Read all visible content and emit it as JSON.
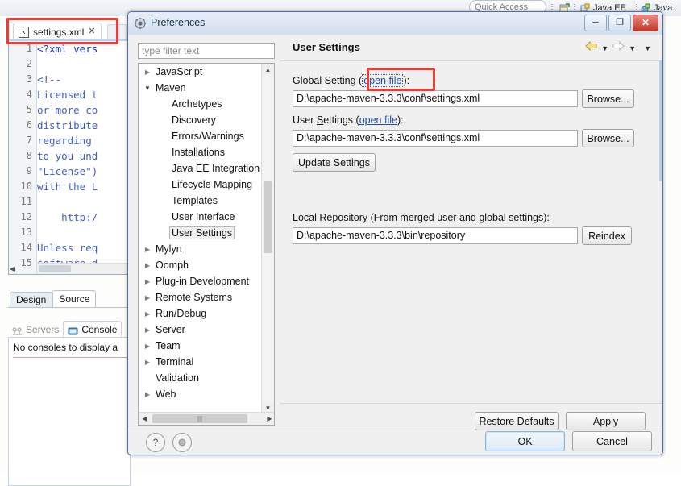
{
  "eclipse": {
    "quick_access": "Quick Access",
    "perspectives": [
      {
        "name": "Java EE",
        "icon": "java-ee-perspective-icon"
      },
      {
        "name": "Java",
        "icon": "java-perspective-icon"
      }
    ],
    "editor_tab": {
      "label": "settings.xml",
      "file_icon": "xml-file-icon",
      "close_icon": "✕"
    },
    "code_lines": [
      {
        "num": "1",
        "text": "<?xml vers"
      },
      {
        "num": "2",
        "text": ""
      },
      {
        "num": "3",
        "text": "<!--"
      },
      {
        "num": "4",
        "text": "Licensed t"
      },
      {
        "num": "5",
        "text": "or more co"
      },
      {
        "num": "6",
        "text": "distribute"
      },
      {
        "num": "7",
        "text": "regarding"
      },
      {
        "num": "8",
        "text": "to you und"
      },
      {
        "num": "9",
        "text": "\"License\")"
      },
      {
        "num": "10",
        "text": "with the L"
      },
      {
        "num": "11",
        "text": ""
      },
      {
        "num": "12",
        "text": "    http:/"
      },
      {
        "num": "13",
        "text": ""
      },
      {
        "num": "14",
        "text": "Unless req"
      },
      {
        "num": "15",
        "text": "software d"
      }
    ],
    "design_source_tabs": [
      {
        "label": "Design",
        "active": false
      },
      {
        "label": "Source",
        "active": true
      }
    ],
    "view_tabs": [
      {
        "label": "Servers",
        "icon": "servers-icon",
        "active": false
      },
      {
        "label": "Console",
        "icon": "console-icon",
        "active": true
      }
    ],
    "console_message": "No consoles to display a"
  },
  "dialog": {
    "title": "Preferences",
    "title_icon": "preferences-gear-icon",
    "window_buttons": [
      {
        "name": "minimize",
        "glyph": "─"
      },
      {
        "name": "maximize",
        "glyph": "❐"
      },
      {
        "name": "close",
        "glyph": "✕"
      }
    ],
    "filter_placeholder": "type filter text",
    "tree": [
      {
        "label": "JavaScript",
        "indent": 0,
        "arrow": "collapsed",
        "selected": false
      },
      {
        "label": "Maven",
        "indent": 0,
        "arrow": "expanded",
        "selected": false
      },
      {
        "label": "Archetypes",
        "indent": 1,
        "arrow": "none",
        "selected": false
      },
      {
        "label": "Discovery",
        "indent": 1,
        "arrow": "none",
        "selected": false
      },
      {
        "label": "Errors/Warnings",
        "indent": 1,
        "arrow": "none",
        "selected": false
      },
      {
        "label": "Installations",
        "indent": 1,
        "arrow": "none",
        "selected": false
      },
      {
        "label": "Java EE Integration",
        "indent": 1,
        "arrow": "none",
        "selected": false
      },
      {
        "label": "Lifecycle Mapping",
        "indent": 1,
        "arrow": "none",
        "selected": false
      },
      {
        "label": "Templates",
        "indent": 1,
        "arrow": "none",
        "selected": false
      },
      {
        "label": "User Interface",
        "indent": 1,
        "arrow": "none",
        "selected": false
      },
      {
        "label": "User Settings",
        "indent": 1,
        "arrow": "none",
        "selected": true
      },
      {
        "label": "Mylyn",
        "indent": 0,
        "arrow": "collapsed",
        "selected": false
      },
      {
        "label": "Oomph",
        "indent": 0,
        "arrow": "collapsed",
        "selected": false
      },
      {
        "label": "Plug-in Development",
        "indent": 0,
        "arrow": "collapsed",
        "selected": false
      },
      {
        "label": "Remote Systems",
        "indent": 0,
        "arrow": "collapsed",
        "selected": false
      },
      {
        "label": "Run/Debug",
        "indent": 0,
        "arrow": "collapsed",
        "selected": false
      },
      {
        "label": "Server",
        "indent": 0,
        "arrow": "collapsed",
        "selected": false
      },
      {
        "label": "Team",
        "indent": 0,
        "arrow": "collapsed",
        "selected": false
      },
      {
        "label": "Terminal",
        "indent": 0,
        "arrow": "collapsed",
        "selected": false
      },
      {
        "label": "Validation",
        "indent": 0,
        "arrow": "none",
        "selected": false
      },
      {
        "label": "Web",
        "indent": 0,
        "arrow": "collapsed",
        "selected": false
      }
    ],
    "page": {
      "title": "User Settings",
      "nav": {
        "back_icon": "back-arrow-icon",
        "forward_icon": "forward-arrow-icon",
        "menu_icon": "view-menu-icon"
      },
      "global_setting": {
        "label_prefix": "Global ",
        "label_underline": "S",
        "label_suffix": "etting ",
        "open_paren": "(",
        "link": "open file",
        "close_paren": "):",
        "value": "D:\\apache-maven-3.3.3\\conf\\settings.xml",
        "browse_label": "Browse..."
      },
      "user_settings": {
        "label_prefix": "User ",
        "label_underline": "S",
        "label_suffix": "ettings ",
        "open_paren": "(",
        "link": "open file",
        "close_paren": "):",
        "value": "D:\\apache-maven-3.3.3\\conf\\settings.xml",
        "browse_label": "Browse..."
      },
      "update_settings_label": "Update Settings",
      "local_repository": {
        "label": "Local Repository (From merged user and global settings):",
        "value": "D:\\apache-maven-3.3.3\\bin\\repository",
        "reindex_label": "Reindex"
      },
      "restore_defaults_label": "Restore Defaults",
      "apply_label": "Apply"
    },
    "footer": {
      "help_icon": "?",
      "record_icon": "record-icon",
      "ok_label": "OK",
      "cancel_label": "Cancel"
    }
  },
  "annotations": {
    "accent_color": "#ef3b33",
    "boxes": [
      {
        "name": "settings-tab-highlight"
      },
      {
        "name": "open-file-link-highlight"
      }
    ]
  }
}
